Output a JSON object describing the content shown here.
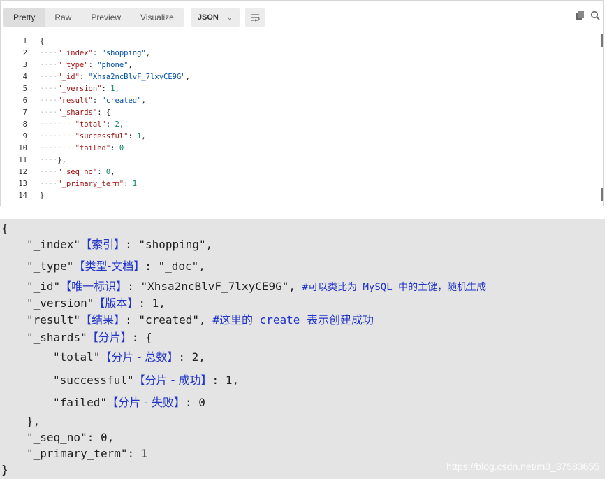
{
  "toolbar": {
    "tabs": [
      "Pretty",
      "Raw",
      "Preview",
      "Visualize"
    ],
    "format": "JSON"
  },
  "code_lines": [
    {
      "n": "1",
      "indent": 0,
      "html": "<span class='p'>{</span>"
    },
    {
      "n": "2",
      "indent": 1,
      "html": "<span class='k'>\"_index\"</span>: <span class='s'>\"shopping\"</span>,"
    },
    {
      "n": "3",
      "indent": 1,
      "html": "<span class='k'>\"_type\"</span>: <span class='s'>\"phone\"</span>,"
    },
    {
      "n": "4",
      "indent": 1,
      "html": "<span class='k'>\"_id\"</span>: <span class='s'>\"Xhsa2ncBlvF_7lxyCE9G\"</span>,"
    },
    {
      "n": "5",
      "indent": 1,
      "html": "<span class='k'>\"_version\"</span>: <span class='n'>1</span>,"
    },
    {
      "n": "6",
      "indent": 1,
      "html": "<span class='k'>\"result\"</span>: <span class='s'>\"created\"</span>,"
    },
    {
      "n": "7",
      "indent": 1,
      "html": "<span class='k'>\"_shards\"</span>: {"
    },
    {
      "n": "8",
      "indent": 2,
      "html": "<span class='k'>\"total\"</span>: <span class='n'>2</span>,"
    },
    {
      "n": "9",
      "indent": 2,
      "html": "<span class='k'>\"successful\"</span>: <span class='n'>1</span>,"
    },
    {
      "n": "10",
      "indent": 2,
      "html": "<span class='k'>\"failed\"</span>: <span class='n'>0</span>"
    },
    {
      "n": "11",
      "indent": 1,
      "html": "},"
    },
    {
      "n": "12",
      "indent": 1,
      "html": "<span class='k'>\"_seq_no\"</span>: <span class='n'>0</span>,"
    },
    {
      "n": "13",
      "indent": 1,
      "html": "<span class='k'>\"_primary_term\"</span>: <span class='n'>1</span>"
    },
    {
      "n": "14",
      "indent": 0,
      "html": "}"
    }
  ],
  "annotated": {
    "open": "{",
    "l1": {
      "a": "\"_index\"",
      "b": "【索引】",
      "c": ": \"shopping\","
    },
    "l2": {
      "a": "\"_type\"",
      "b": "【类型-文档】",
      "c": ": \"_doc\","
    },
    "l3": {
      "a": "\"_id\"",
      "b": "【唯一标识】",
      "c": ": \"Xhsa2ncBlvF_7lxyCE9G\", ",
      "d": "#可以类比为 MySQL 中的主键，随机生成"
    },
    "l4": {
      "a": "\"_version\"",
      "b": "【版本】",
      "c": ": 1,"
    },
    "l5": {
      "a": "\"result\"",
      "b": "【结果】",
      "c": ": \"created\", ",
      "d": "#这里的 create 表示创建成功"
    },
    "l6": {
      "a": "\"_shards\"",
      "b": "【分片】",
      "c": ": {"
    },
    "l7": {
      "a": "\"total\"",
      "b": "【分片 - 总数】",
      "c": ": 2,"
    },
    "l8": {
      "a": "\"successful\"",
      "b": "【分片 - 成功】",
      "c": ": 1,"
    },
    "l9": {
      "a": "\"failed\"",
      "b": "【分片 - 失败】",
      "c": ": 0"
    },
    "l10": "},",
    "l11": "\"_seq_no\": 0,",
    "l12": "\"_primary_term\": 1",
    "close": "}",
    "watermark": "https://blog.csdn.net/m0_37583655"
  }
}
